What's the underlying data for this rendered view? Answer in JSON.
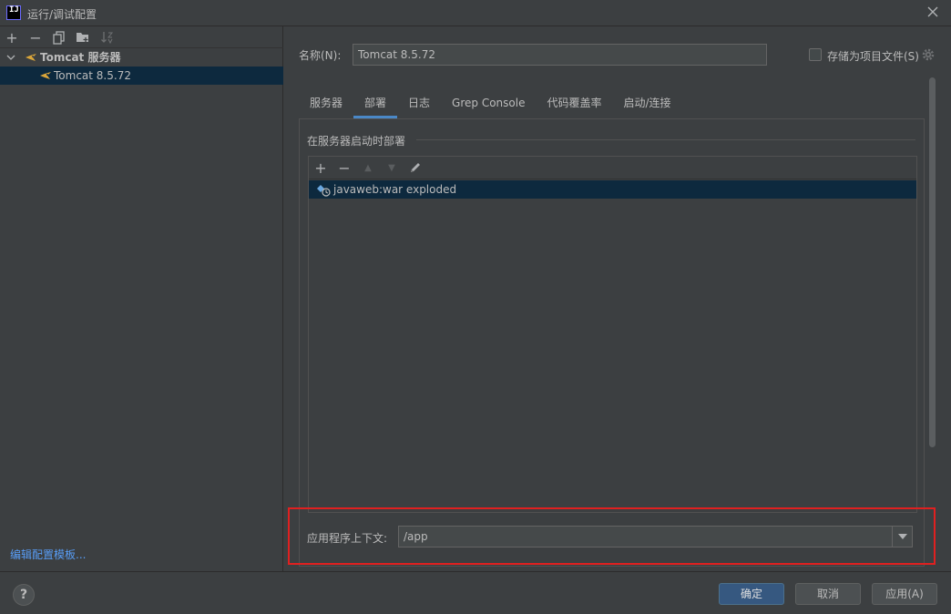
{
  "window": {
    "title": "运行/调试配置",
    "app_icon_text": "IJ"
  },
  "left_toolbar": {
    "icons": [
      "add-icon",
      "remove-icon",
      "copy-icon",
      "folder-icon",
      "sort-icon"
    ],
    "add_glyph": "+",
    "remove_glyph": "−"
  },
  "tree": {
    "group_label": "Tomcat 服务器",
    "item_label": "Tomcat 8.5.72"
  },
  "edit_templates_link": "编辑配置模板...",
  "form": {
    "name_label": "名称(N):",
    "name_value": "Tomcat 8.5.72",
    "store_as_project_file_label": "存储为项目文件(S)",
    "store_as_project_file_checked": false
  },
  "tabs": [
    {
      "label": "服务器",
      "active": false
    },
    {
      "label": "部署",
      "active": true
    },
    {
      "label": "日志",
      "active": false
    },
    {
      "label": "Grep Console",
      "active": false
    },
    {
      "label": "代码覆盖率",
      "active": false
    },
    {
      "label": "启动/连接",
      "active": false
    }
  ],
  "deploy": {
    "section_title": "在服务器启动时部署",
    "toolbar": {
      "add_glyph": "+",
      "remove_glyph": "−",
      "up_glyph": "▲",
      "down_glyph": "▼"
    },
    "items": [
      {
        "label": "javaweb:war exploded",
        "selected": true
      }
    ],
    "context_label": "应用程序上下文:",
    "context_value": "/app"
  },
  "buttons": {
    "help": "?",
    "ok": "确定",
    "cancel": "取消",
    "apply": "应用(A)"
  },
  "colors": {
    "background": "#3c3f41",
    "selection": "#0d293e",
    "link": "#589df6",
    "tab_underline": "#4a88c7",
    "primary_button": "#365880",
    "highlight_border": "#e02020"
  }
}
